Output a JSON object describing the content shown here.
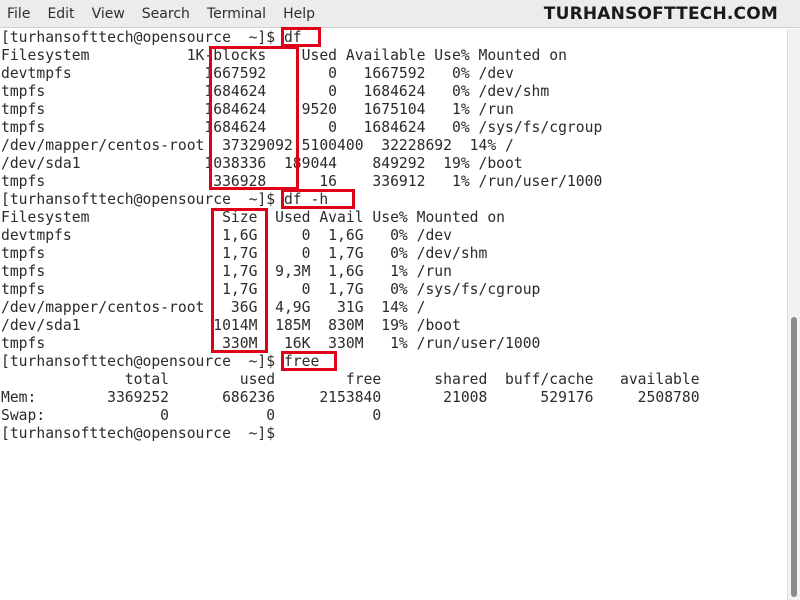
{
  "menubar": {
    "items": [
      "File",
      "Edit",
      "View",
      "Search",
      "Terminal",
      "Help"
    ]
  },
  "watermark": "TURHANSOFTTECH.COM",
  "terminal": {
    "lines": [
      "[turhansofttech@opensource  ~]$ df",
      "Filesystem           1K-blocks    Used Available Use% Mounted on",
      "devtmpfs               1667592       0   1667592   0% /dev",
      "tmpfs                  1684624       0   1684624   0% /dev/shm",
      "tmpfs                  1684624    9520   1675104   1% /run",
      "tmpfs                  1684624       0   1684624   0% /sys/fs/cgroup",
      "/dev/mapper/centos-root  37329092 5100400  32228692  14% /",
      "/dev/sda1              1038336  189044    849292  19% /boot",
      "tmpfs                   336928      16    336912   1% /run/user/1000",
      "[turhansofttech@opensource  ~]$ df -h",
      "Filesystem               Size  Used Avail Use% Mounted on",
      "devtmpfs                 1,6G     0  1,6G   0% /dev",
      "tmpfs                    1,7G     0  1,7G   0% /dev/shm",
      "tmpfs                    1,7G  9,3M  1,6G   1% /run",
      "tmpfs                    1,7G     0  1,7G   0% /sys/fs/cgroup",
      "/dev/mapper/centos-root   36G  4,9G   31G  14% /",
      "/dev/sda1               1014M  185M  830M  19% /boot",
      "tmpfs                    330M   16K  330M   1% /run/user/1000",
      "[turhansofttech@opensource  ~]$ free",
      "              total        used        free      shared  buff/cache   available",
      "Mem:        3369252      686236     2153840       21008      529176     2508780",
      "Swap:             0           0           0",
      "[turhansofttech@opensource  ~]$"
    ]
  },
  "highlight_color": "#e0001a"
}
